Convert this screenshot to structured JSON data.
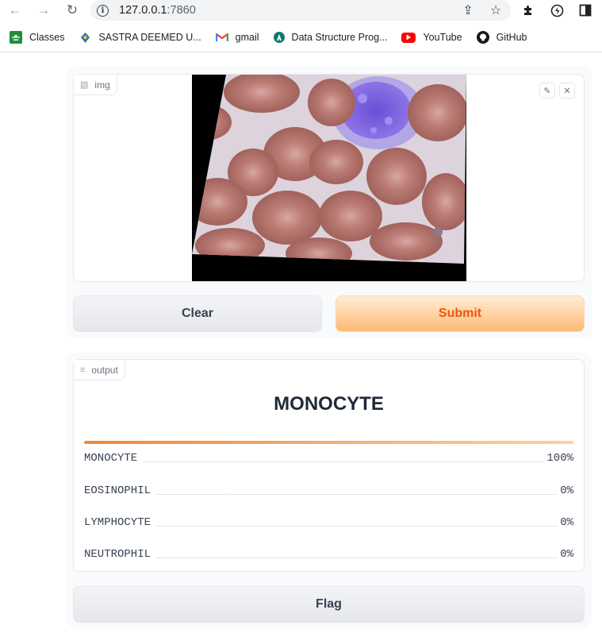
{
  "browser": {
    "url_host": "127.0.0.1",
    "url_port": ":7860",
    "bookmarks": [
      {
        "label": "Classes",
        "icon": "google-classroom-icon",
        "color": "#1e8e3e"
      },
      {
        "label": "SASTRA DEEMED U...",
        "icon": "sastra-logo-icon",
        "color": "#2f6fb5"
      },
      {
        "label": "gmail",
        "icon": "gmail-icon",
        "color": "#ea4335"
      },
      {
        "label": "Data Structure Prog...",
        "icon": "site-logo-icon",
        "color": "#0f7a6e"
      },
      {
        "label": "YouTube",
        "icon": "youtube-icon",
        "color": "#ff0000"
      },
      {
        "label": "GitHub",
        "icon": "github-icon",
        "color": "#181717"
      }
    ]
  },
  "input": {
    "label": "img",
    "clear_label": "Clear",
    "submit_label": "Submit"
  },
  "output": {
    "label": "output",
    "prediction": "MONOCYTE",
    "confidence_fraction": 1.0,
    "confidences": [
      {
        "label": "MONOCYTE",
        "value": "100%"
      },
      {
        "label": "EOSINOPHIL",
        "value": "0%"
      },
      {
        "label": "LYMPHOCYTE",
        "value": "0%"
      },
      {
        "label": "NEUTROPHIL",
        "value": "0%"
      }
    ]
  },
  "flag_label": "Flag",
  "colors": {
    "accent": "#f97316",
    "primary_button_text": "#ea580c"
  }
}
